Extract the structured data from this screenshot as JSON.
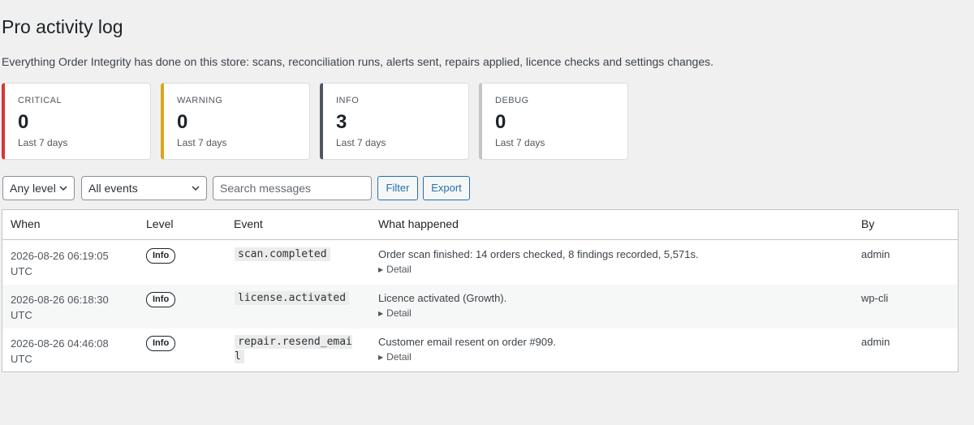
{
  "page": {
    "title": "Pro activity log",
    "description": "Everything Order Integrity has done on this store: scans, reconciliation runs, alerts sent, repairs applied, licence checks and settings changes."
  },
  "cards": [
    {
      "label": "CRITICAL",
      "count": "0",
      "sub": "Last 7 days",
      "color": "#d63638"
    },
    {
      "label": "WARNING",
      "count": "0",
      "sub": "Last 7 days",
      "color": "#dba617"
    },
    {
      "label": "INFO",
      "count": "3",
      "sub": "Last 7 days",
      "color": "#50575e"
    },
    {
      "label": "DEBUG",
      "count": "0",
      "sub": "Last 7 days",
      "color": "#c3c4c7"
    }
  ],
  "filters": {
    "level_selected": "Any level",
    "event_selected": "All events",
    "search_placeholder": "Search messages",
    "filter_label": "Filter",
    "export_label": "Export"
  },
  "table": {
    "headers": {
      "when": "When",
      "level": "Level",
      "event": "Event",
      "what": "What happened",
      "by": "By"
    },
    "rows": [
      {
        "when_line1": "2026-08-26 06:19:05",
        "when_line2": "UTC",
        "level": "Info",
        "event": "scan.completed",
        "what": "Order scan finished: 14 orders checked, 8 findings recorded, 5,571s.",
        "detail": "Detail",
        "by": "admin"
      },
      {
        "when_line1": "2026-08-26 06:18:30",
        "when_line2": "UTC",
        "level": "Info",
        "event": "license.activated",
        "what": "Licence activated (Growth).",
        "detail": "Detail",
        "by": "wp-cli"
      },
      {
        "when_line1": "2026-08-26 04:46:08",
        "when_line2": "UTC",
        "level": "Info",
        "event": "repair.resend_email",
        "what": "Customer email resent on order #909.",
        "detail": "Detail",
        "by": "admin"
      }
    ]
  },
  "icons": {
    "select_caret": "chevron-down-icon",
    "detail_caret": "triangle-right-icon"
  },
  "colors": {
    "button_blue": "#2271b1"
  }
}
